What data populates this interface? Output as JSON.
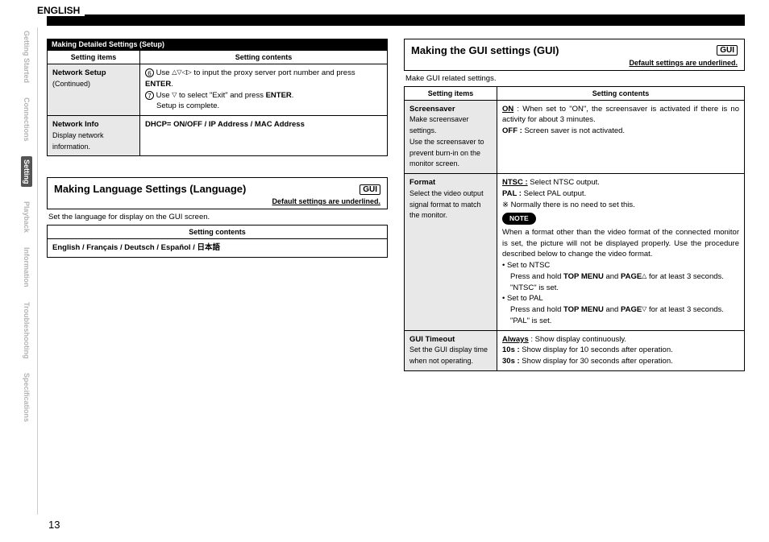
{
  "language_tab": "ENGLISH",
  "sidebar": {
    "tabs": [
      {
        "label": "Getting Started",
        "active": false
      },
      {
        "label": "Connections",
        "active": false
      },
      {
        "label": "Setting",
        "active": true
      },
      {
        "label": "Playback",
        "active": false
      },
      {
        "label": "Information",
        "active": false
      },
      {
        "label": "Troubleshooting",
        "active": false
      },
      {
        "label": "Specifications",
        "active": false
      }
    ]
  },
  "section_bar": "Making Detailed Settings (Setup)",
  "table1": {
    "head_items": "Setting items",
    "head_contents": "Setting contents",
    "rows": [
      {
        "item_title": "Network Setup",
        "item_desc": "(Continued)",
        "content": {
          "step6_num": "6",
          "step6a": "Use ",
          "step6_arrows": "△▽◁▷",
          "step6b": " to input the proxy server port number and press ",
          "enter": "ENTER",
          "step6c": ".",
          "step7_num": "7",
          "step7a": "Use ",
          "step7_arrow": "▽",
          "step7b": " to select \"Exit\" and press ",
          "step7c": ".",
          "step7d": "Setup is complete."
        }
      },
      {
        "item_title": "Network Info",
        "item_desc": "Display network information.",
        "content_text": "DHCP= ON/OFF / IP Address / MAC Address"
      }
    ]
  },
  "lang_section": {
    "title": "Making Language Settings (Language)",
    "gui": "GUI",
    "default_note": "Default settings are underlined.",
    "intro": "Set the language for display on the GUI screen.",
    "head": "Setting contents",
    "options": "English / Français / Deutsch / Español / 日本語"
  },
  "gui_section": {
    "title": "Making the GUI settings (GUI)",
    "gui": "GUI",
    "default_note": "Default settings are underlined.",
    "intro": "Make GUI related settings.",
    "head_items": "Setting items",
    "head_contents": "Setting contents",
    "rows": {
      "screensaver": {
        "title": "Screensaver",
        "desc": "Make screensaver settings.\nUse the screensaver to prevent burn-in on the monitor screen.",
        "on_label": "ON",
        "on_text": " : When set to \"ON\", the screensaver is activated if there is no activity for about 3 minutes.",
        "off_label": "OFF :",
        "off_text": " Screen saver is not activated."
      },
      "format": {
        "title": "Format",
        "desc": "Select the video output signal format to match the monitor.",
        "ntsc_label": "NTSC :",
        "ntsc_text": " Select NTSC output.",
        "pal_label": "PAL :",
        "pal_text": " Select PAL output.",
        "note_star": "※ Normally there is no need to set this.",
        "note_pill": "NOTE",
        "note_body": "When a format other than the video format of the connected monitor is set, the picture will not be displayed properly. Use the procedure described below to change the video format.",
        "bullet1": "Set to NTSC",
        "b1_line": "Press and hold ",
        "topmenu": "TOP MENU",
        "b1_and": " and ",
        "page": "PAGE",
        "b1_up": "△",
        "b1_tail": " for at least 3 seconds.",
        "b1_result": "\"NTSC\" is set.",
        "bullet2": "Set to PAL",
        "b2_down": "▽",
        "b2_result": "\"PAL\" is set."
      },
      "timeout": {
        "title": "GUI Timeout",
        "desc": "Set the GUI display time when not operating.",
        "always_label": "Always",
        "always_text": " : Show display continuously.",
        "t10_label": "10s :",
        "t10_text": " Show display for 10 seconds after operation.",
        "t30_label": "30s :",
        "t30_text": " Show display for 30 seconds after operation."
      }
    }
  },
  "page_number": "13"
}
